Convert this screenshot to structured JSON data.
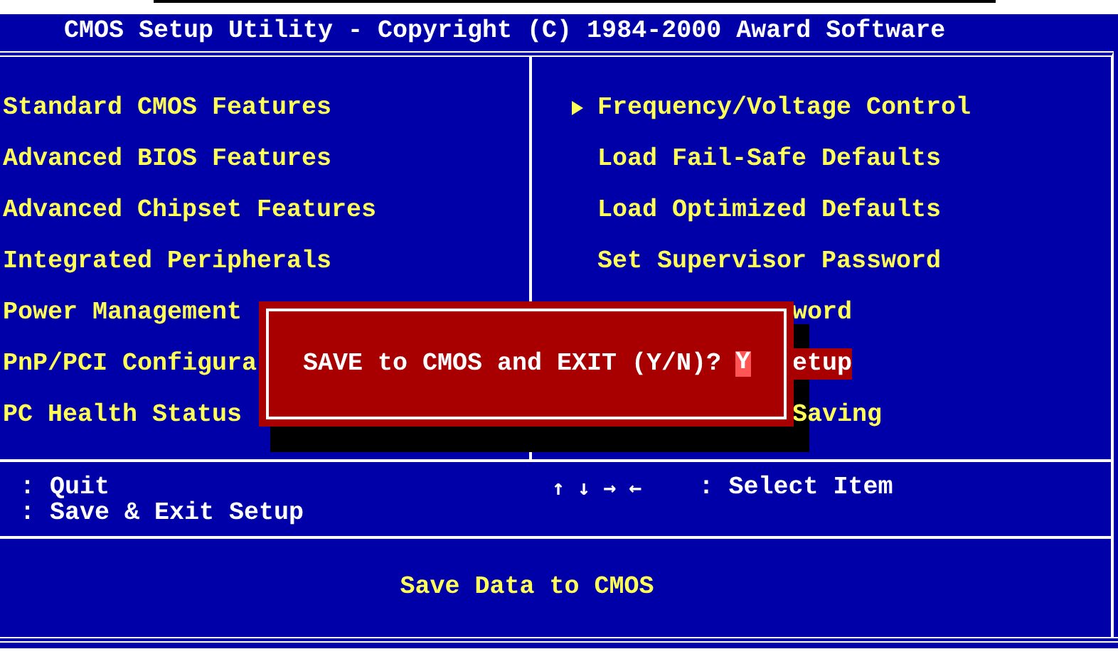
{
  "title": "CMOS Setup Utility - Copyright (C) 1984-2000 Award Software",
  "left_menu": [
    {
      "text": "Standard CMOS Features",
      "selected": false
    },
    {
      "text": "Advanced BIOS Features",
      "selected": false
    },
    {
      "text": "Advanced Chipset Features",
      "selected": false
    },
    {
      "text": "Integrated Peripherals",
      "selected": false
    },
    {
      "text": "Power Management",
      "selected": false
    },
    {
      "text": "PnP/PCI Configura",
      "selected": false
    },
    {
      "text": "PC Health Status",
      "selected": false
    }
  ],
  "right_menu": [
    {
      "kind": "submenu",
      "text": "Frequency/Voltage Control",
      "selected": false
    },
    {
      "kind": "full",
      "text": "Load Fail-Safe Defaults",
      "selected": false
    },
    {
      "kind": "full",
      "text": "Load Optimized Defaults",
      "selected": false
    },
    {
      "kind": "full",
      "text": "Set Supervisor Password",
      "selected": false
    },
    {
      "kind": "tail",
      "text": "word",
      "selected": false
    },
    {
      "kind": "tail",
      "text": "etup",
      "selected": true
    },
    {
      "kind": "tail",
      "text": "Saving",
      "selected": false
    }
  ],
  "keys_left": [
    ": Quit",
    ": Save & Exit Setup"
  ],
  "keys_right": [
    {
      "keys": "↑ ↓ → ←",
      "action": ": Select Item"
    }
  ],
  "message": "Save Data to CMOS",
  "dialog": {
    "prompt": "SAVE to CMOS and EXIT (Y/N)?",
    "answer": "Y"
  }
}
